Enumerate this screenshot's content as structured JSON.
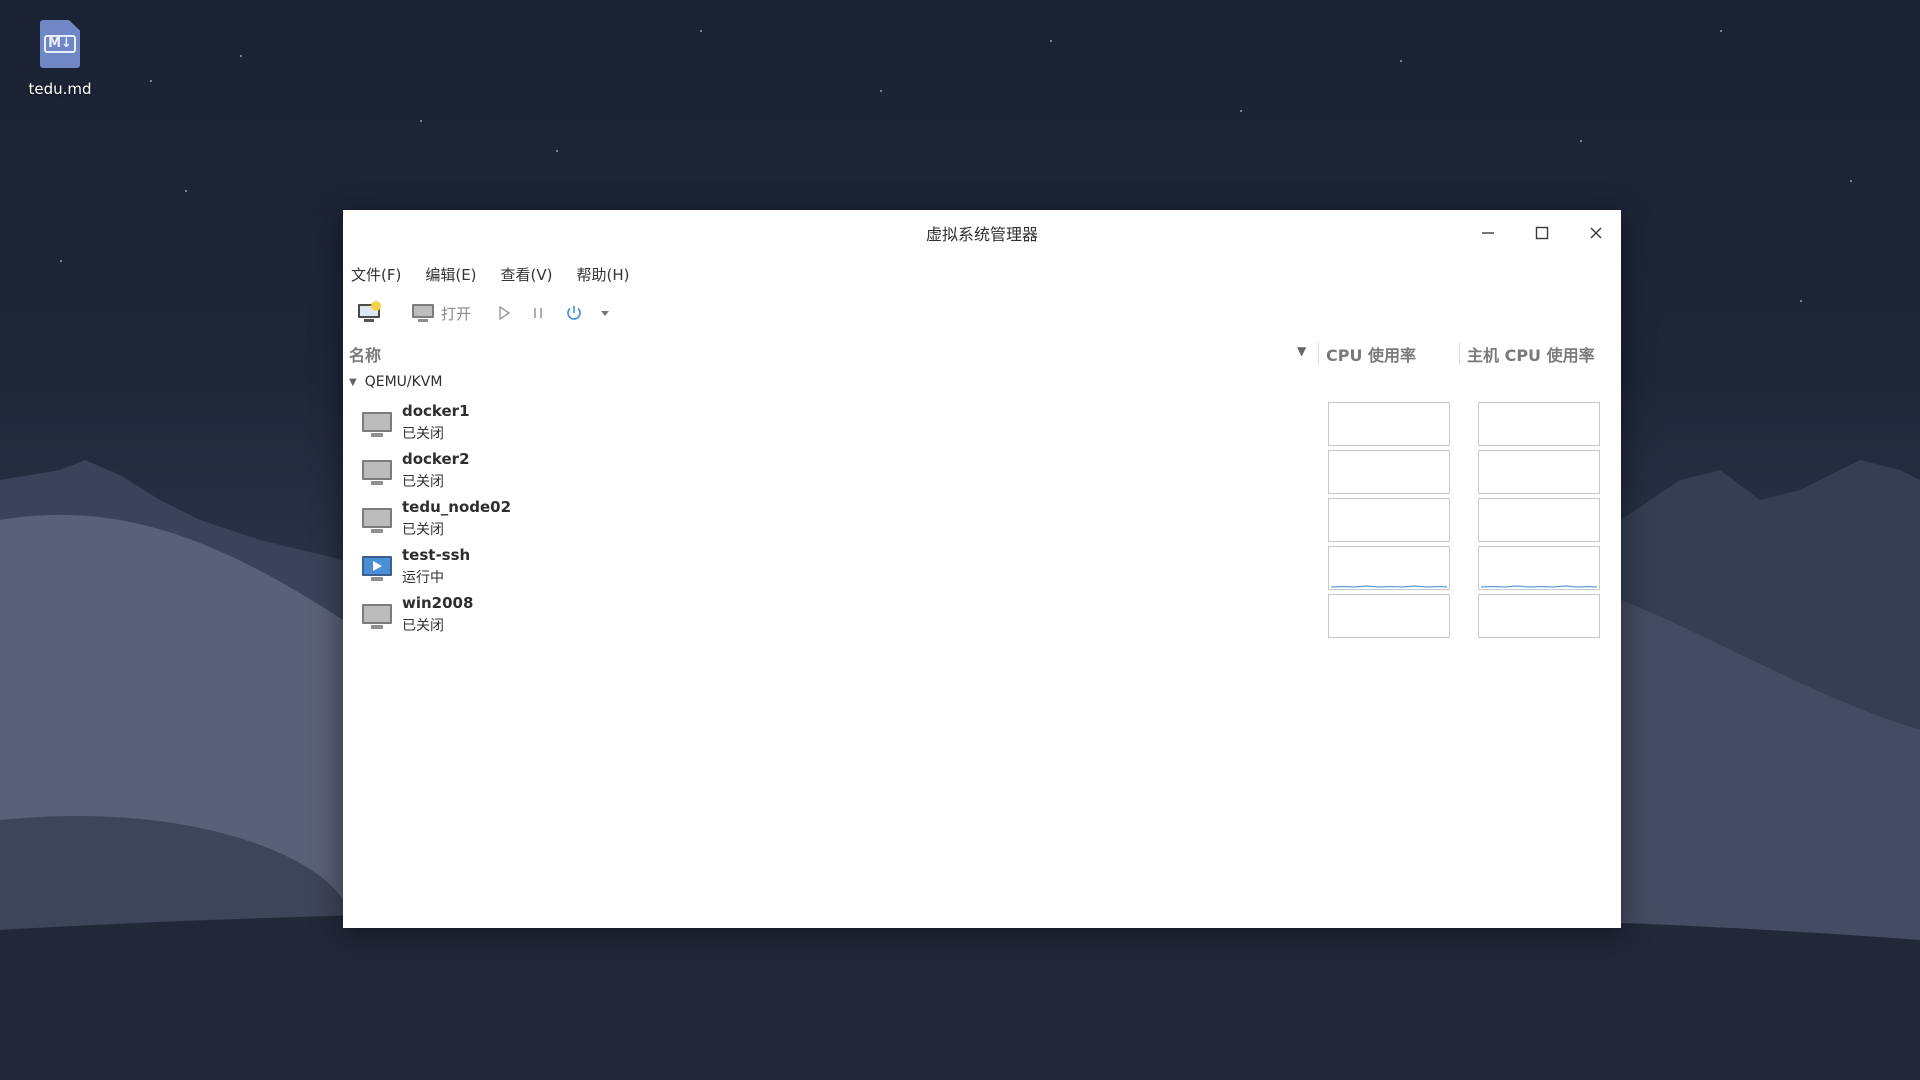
{
  "desktop": {
    "icon": {
      "file_badge": "M↓",
      "label": "tedu.md"
    }
  },
  "window": {
    "title": "虚拟系统管理器",
    "controls": {
      "minimize": "–",
      "maximize": "☐",
      "close": "✕"
    }
  },
  "menubar": {
    "items": [
      {
        "label": "文件(F)"
      },
      {
        "label": "编辑(E)"
      },
      {
        "label": "查看(V)"
      },
      {
        "label": "帮助(H)"
      }
    ]
  },
  "toolbar": {
    "open_label": "打开",
    "icons": [
      "new-vm-icon",
      "open-console-icon",
      "run-icon",
      "pause-icon",
      "shutdown-icon",
      "dropdown-arrow-icon"
    ],
    "accent": "#3d8fd8"
  },
  "table": {
    "columns": {
      "name": "名称",
      "cpu": "CPU 使用率",
      "host_cpu": "主机 CPU 使用率"
    },
    "group": "QEMU/KVM",
    "rows": [
      {
        "name": "docker1",
        "status": "已关闭",
        "running": false
      },
      {
        "name": "docker2",
        "status": "已关闭",
        "running": false
      },
      {
        "name": "tedu_node02",
        "status": "已关闭",
        "running": false
      },
      {
        "name": "test-ssh",
        "status": "运行中",
        "running": true
      },
      {
        "name": "win2008",
        "status": "已关闭",
        "running": false
      }
    ]
  }
}
